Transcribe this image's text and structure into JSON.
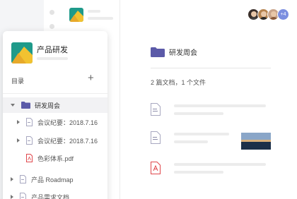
{
  "workspace": {
    "title": "产品研发",
    "toc_label": "目录",
    "add_symbol": "+"
  },
  "tree": [
    {
      "label": "研发周会",
      "icon": "folder-icon",
      "expanded": true,
      "level": 0
    },
    {
      "label": "会议纪要：2018.7.16",
      "icon": "doc-icon",
      "level": 1,
      "has_caret": true
    },
    {
      "label": "会议纪要：2018.7.16",
      "icon": "doc-icon",
      "level": 1,
      "has_caret": true
    },
    {
      "label": "色彩体系.pdf",
      "icon": "pdf-icon",
      "level": 1,
      "has_caret": false
    },
    {
      "label": "产品 Roadmap",
      "icon": "doc-icon",
      "level": 0,
      "has_caret": true
    },
    {
      "label": "产品需求文档",
      "icon": "doc-icon",
      "level": 0,
      "has_caret": true
    }
  ],
  "main": {
    "folder_title": "研发周会",
    "summary": "2 篇文档，1 个文件",
    "avatars": {
      "more_label": "+4"
    },
    "documents": [
      {
        "icon": "doc-icon",
        "has_thumbnail": false
      },
      {
        "icon": "doc-icon",
        "has_thumbnail": true
      },
      {
        "icon": "pdf-icon",
        "has_thumbnail": false
      }
    ]
  },
  "colors": {
    "folder": "#5b5aa8",
    "pdf": "#e0474c",
    "doc": "#8a8aa8",
    "avatar_more": "#7b8ee0"
  }
}
